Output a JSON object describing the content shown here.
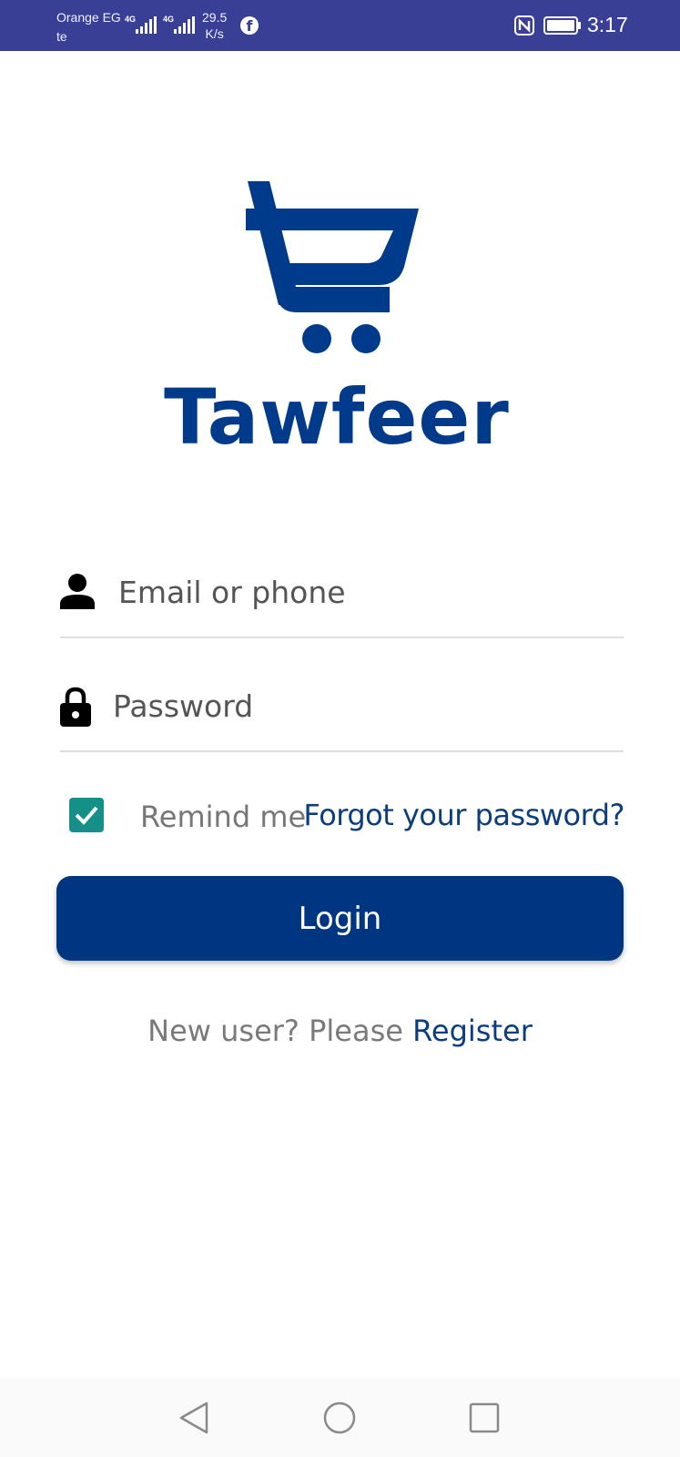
{
  "status_bar": {
    "carrier": "Orange EG te",
    "network_1": "4G",
    "network_2": "4G",
    "speed_value": "29.5",
    "speed_unit": "K/s",
    "time": "3:17",
    "icons": [
      "facebook-icon",
      "nfc-icon",
      "battery-icon"
    ]
  },
  "brand": {
    "name": "Tawfeer",
    "color": "#003a8a"
  },
  "login_form": {
    "email_placeholder": "Email or phone",
    "password_placeholder": "Password",
    "remember_label": "Remind me",
    "remember_checked": true,
    "forgot_link": "Forgot your password?",
    "login_button": "Login"
  },
  "register": {
    "prefix": "New user? Please",
    "link": "Register"
  },
  "colors": {
    "status_bar": "#3a3f96",
    "primary": "#003582",
    "checkbox": "#149088",
    "link": "#0c3e7e"
  },
  "nav_bar": {
    "icons": [
      "back-icon",
      "home-icon",
      "recents-icon"
    ]
  }
}
